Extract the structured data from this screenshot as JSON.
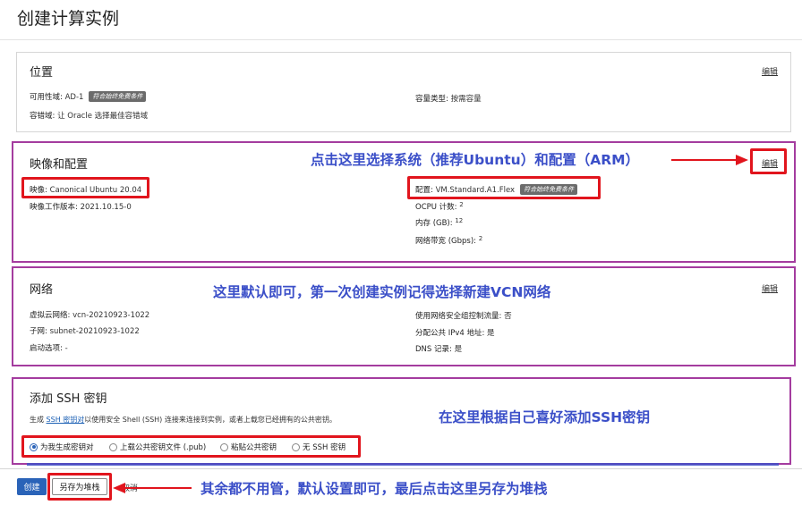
{
  "page": {
    "title": "创建计算实例"
  },
  "location": {
    "title": "位置",
    "edit": "编辑",
    "availability_domain": {
      "label": "可用性域:",
      "value": "AD-1",
      "badge": "符合始终免费条件"
    },
    "capacity_type": {
      "label": "容量类型:",
      "value": "按需容量"
    },
    "fault_domain": {
      "label": "容错域:",
      "value": "让 Oracle 选择最佳容错域"
    }
  },
  "image": {
    "title": "映像和配置",
    "edit": "编辑",
    "image_name": {
      "label": "映像:",
      "value": "Canonical Ubuntu 20.04"
    },
    "image_build": {
      "label": "映像工作版本:",
      "value": "2021.10.15-0"
    },
    "shape": {
      "label": "配置:",
      "value": "VM.Standard.A1.Flex",
      "badge": "符合始终免费条件"
    },
    "ocpu": {
      "label": "OCPU 计数:",
      "value": "2"
    },
    "memory": {
      "label": "内存 (GB):",
      "value": "12"
    },
    "bandwidth": {
      "label": "网络带宽 (Gbps):",
      "value": "2"
    }
  },
  "network": {
    "title": "网络",
    "edit": "编辑",
    "vcn": {
      "label": "虚拟云网络:",
      "value": "vcn-20210923-1022"
    },
    "subnet": {
      "label": "子网:",
      "value": "subnet-20210923-1022"
    },
    "launch_options": {
      "label": "启动选项:",
      "value": "-"
    },
    "nsg": {
      "label": "使用网络安全组控制流量:",
      "value": "否"
    },
    "public_ip": {
      "label": "分配公共 IPv4 地址:",
      "value": "是"
    },
    "dns": {
      "label": "DNS 记录:",
      "value": "是"
    }
  },
  "ssh": {
    "title": "添加 SSH 密钥",
    "desc_prefix": "生成",
    "desc_link": "SSH 密钥对",
    "desc_suffix": "以使用安全 Shell (SSH) 连接来连接到实例，或者上载您已经拥有的公共密钥。",
    "options": [
      "为我生成密钥对",
      "上载公共密钥文件 (.pub)",
      "粘贴公共密钥",
      "无 SSH 密钥"
    ]
  },
  "footer": {
    "create": "创建",
    "save_stack": "另存为堆栈",
    "cancel": "取消"
  },
  "annotations": {
    "image": "点击这里选择系统（推荐Ubuntu）和配置（ARM）",
    "network": "这里默认即可，第一次创建实例记得选择新建VCN网络",
    "ssh": "在这里根据自己喜好添加SSH密钥",
    "footer": "其余都不用管，默认设置即可，最后点击这里另存为堆栈"
  },
  "colors": {
    "annotation_text": "#3b4fc8",
    "highlight_box": "#a43c9f",
    "red_box": "#e1151d",
    "primary_button": "#2a63b8"
  }
}
